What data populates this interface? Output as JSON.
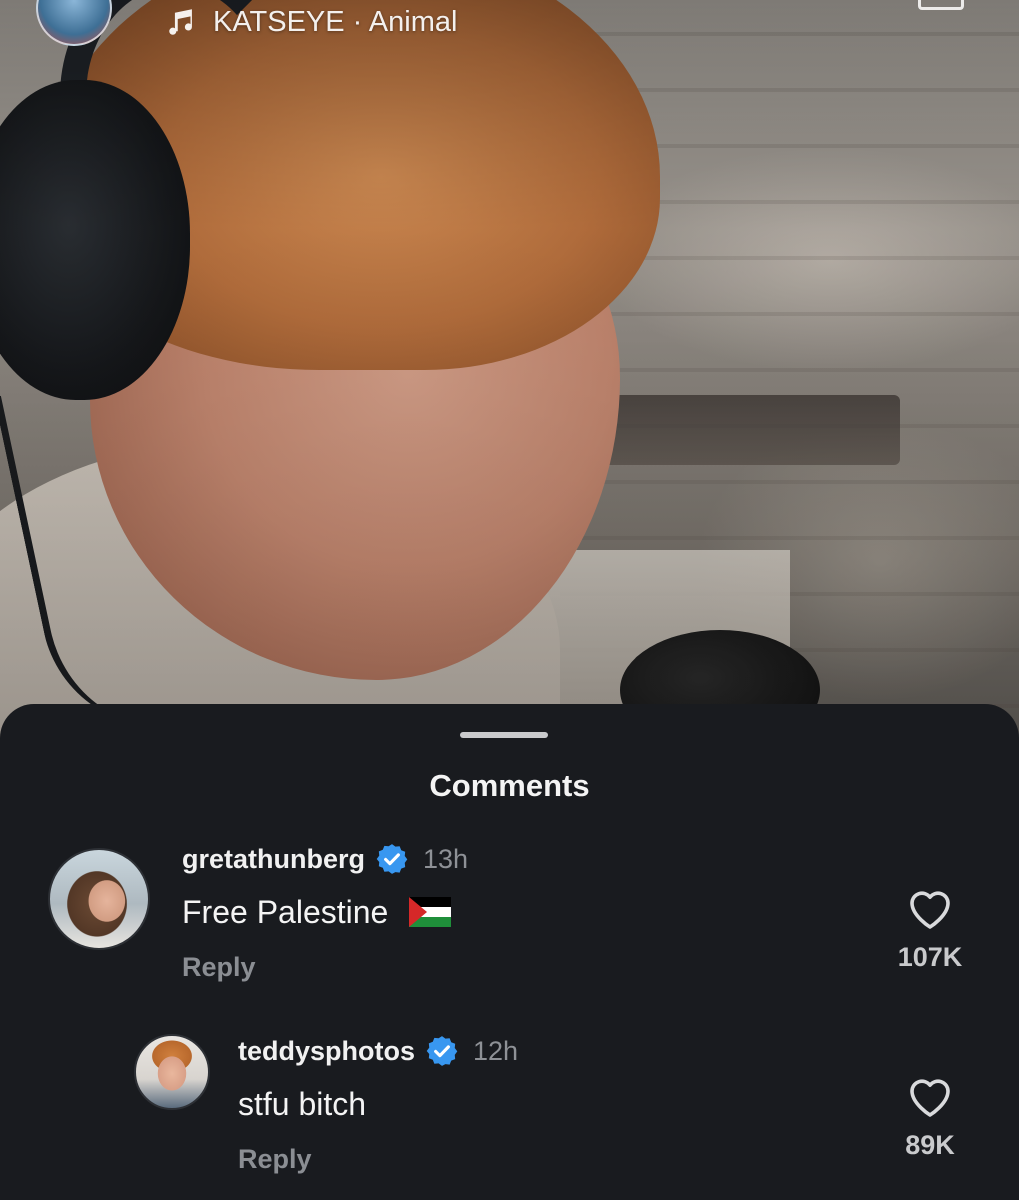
{
  "now_playing": {
    "icon": "music-note-icon",
    "text": "KATSEYE · Animal"
  },
  "sheet": {
    "title": "Comments"
  },
  "comments": [
    {
      "username": "gretathunberg",
      "verified": true,
      "time": "13h",
      "text": "Free Palestine",
      "emoji": "palestine-flag",
      "reply_label": "Reply",
      "likes": "107K"
    },
    {
      "username": "teddysphotos",
      "verified": true,
      "time": "12h",
      "text": "stfu bitch",
      "reply_label": "Reply",
      "likes": "89K"
    }
  ],
  "colors": {
    "sheet_bg": "#191b1f",
    "verified_badge": "#3897f0",
    "muted_text": "#8e9196"
  }
}
